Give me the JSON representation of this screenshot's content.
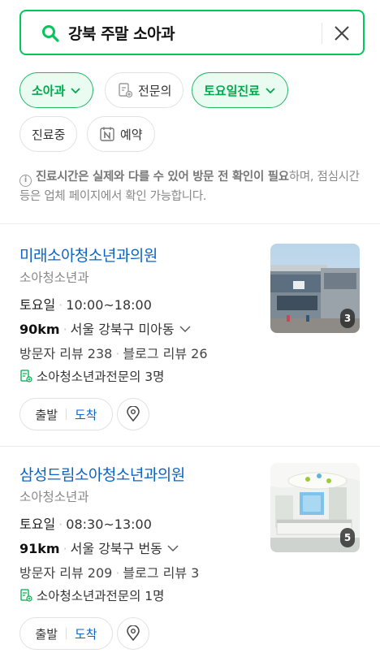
{
  "search": {
    "query": "강북 주말 소아과"
  },
  "filters": [
    {
      "label": "소아과",
      "active": true,
      "has_chevron": true,
      "icon": ""
    },
    {
      "label": "전문의",
      "active": false,
      "has_chevron": false,
      "icon": "doctor-certificate-icon"
    },
    {
      "label": "토요일진료",
      "active": true,
      "has_chevron": true,
      "icon": ""
    },
    {
      "label": "진료중",
      "active": false,
      "has_chevron": false,
      "icon": ""
    },
    {
      "label": "예약",
      "active": false,
      "has_chevron": false,
      "icon": "naver-booking-icon"
    }
  ],
  "notice": {
    "bold": "진료시간은 실제와 다를 수 있어 방문 전 확인이 필요",
    "rest": "하며, 점심시간 등은 업체 페이지에서 확인 가능합니다."
  },
  "results": [
    {
      "name": "미래소아청소년과의원",
      "category": "소아청소년과",
      "day": "토요일",
      "time": "10:00~18:00",
      "distance": "90km",
      "address": "서울 강북구 미아동",
      "visitor_reviews": "방문자 리뷰 238",
      "blog_reviews": "블로그 리뷰 26",
      "specialist": "소아청소년과전문의 3명",
      "photo_count": "3",
      "start_label": "출발",
      "arrive_label": "도착"
    },
    {
      "name": "삼성드림소아청소년과의원",
      "category": "소아청소년과",
      "day": "토요일",
      "time": "08:30~13:00",
      "distance": "91km",
      "address": "서울 강북구 번동",
      "visitor_reviews": "방문자 리뷰 209",
      "blog_reviews": "블로그 리뷰 3",
      "specialist": "소아청소년과전문의 1명",
      "photo_count": "5",
      "start_label": "출발",
      "arrive_label": "도착"
    }
  ],
  "colors": {
    "accent": "#03c75a",
    "link": "#0b63c9"
  }
}
